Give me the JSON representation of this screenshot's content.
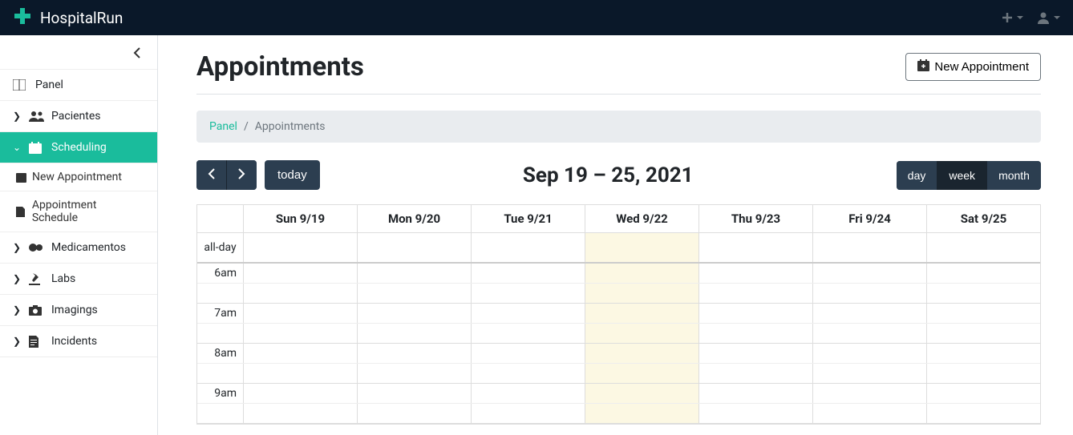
{
  "brand": "HospitalRun",
  "sidebar": {
    "panel": "Panel",
    "pacientes": "Pacientes",
    "scheduling": "Scheduling",
    "newAppointment": "New Appointment",
    "appointmentSchedule": "Appointment Schedule",
    "medicamentos": "Medicamentos",
    "labs": "Labs",
    "imagings": "Imagings",
    "incidents": "Incidents"
  },
  "page": {
    "title": "Appointments",
    "newAppointmentBtn": "New Appointment"
  },
  "breadcrumb": {
    "home": "Panel",
    "current": "Appointments"
  },
  "calendar": {
    "todayBtn": "today",
    "title": "Sep 19 – 25, 2021",
    "views": {
      "day": "day",
      "week": "week",
      "month": "month"
    },
    "allDay": "all-day",
    "days": [
      "Sun 9/19",
      "Mon 9/20",
      "Tue 9/21",
      "Wed 9/22",
      "Thu 9/23",
      "Fri 9/24",
      "Sat 9/25"
    ],
    "todayIndex": 3,
    "hours": [
      "6am",
      "7am",
      "8am",
      "9am"
    ]
  }
}
